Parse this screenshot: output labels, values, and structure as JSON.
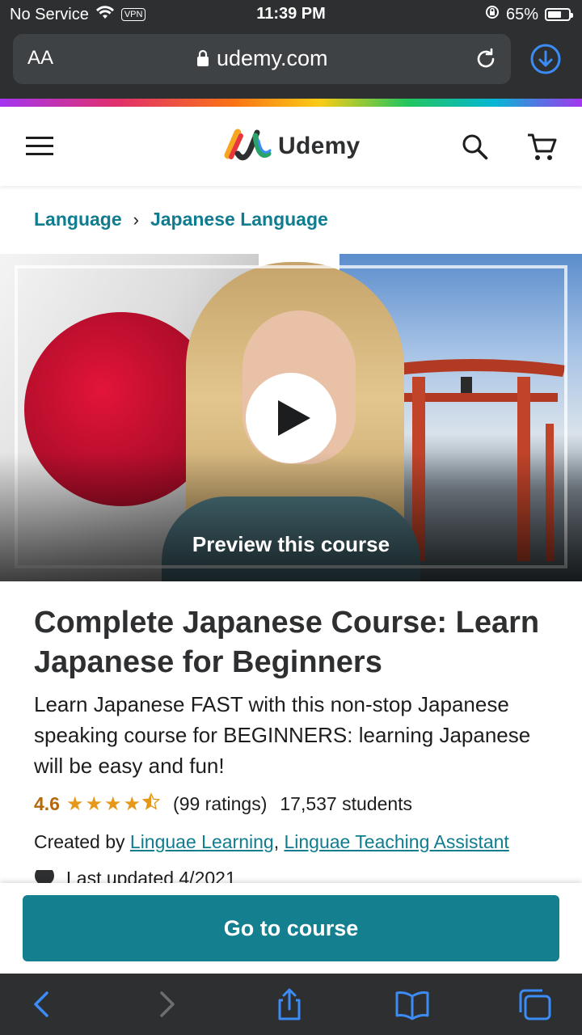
{
  "status_bar": {
    "carrier": "No Service",
    "vpn": "VPN",
    "time": "11:39 PM",
    "battery": "65%",
    "battery_level": 0.65
  },
  "browser": {
    "text_size_label": "AA",
    "url": "udemy.com"
  },
  "header": {
    "logo_text": "Udemy"
  },
  "breadcrumb": {
    "items": [
      "Language",
      "Japanese Language"
    ],
    "separator": "›"
  },
  "preview": {
    "label": "Preview this course"
  },
  "course": {
    "title": "Complete Japanese Course: Learn Japanese for Beginners",
    "subtitle": "Learn Japanese FAST with this non-stop Japanese speaking course for BEGINNERS: learning Japanese will be easy and fun!",
    "rating": "4.6",
    "rating_stars": 4.5,
    "ratings_count": "(99 ratings)",
    "students": "17,537 students",
    "created_by_label": "Created by",
    "instructors": [
      "Linguae Learning",
      "Linguae Teaching Assistant"
    ],
    "last_updated": "Last updated 4/2021"
  },
  "cta": {
    "label": "Go to course"
  },
  "colors": {
    "brand_teal": "#14808f",
    "link": "#0f7c90",
    "rating": "#b4690e",
    "star": "#e59819",
    "chrome": "#2d2f31"
  }
}
